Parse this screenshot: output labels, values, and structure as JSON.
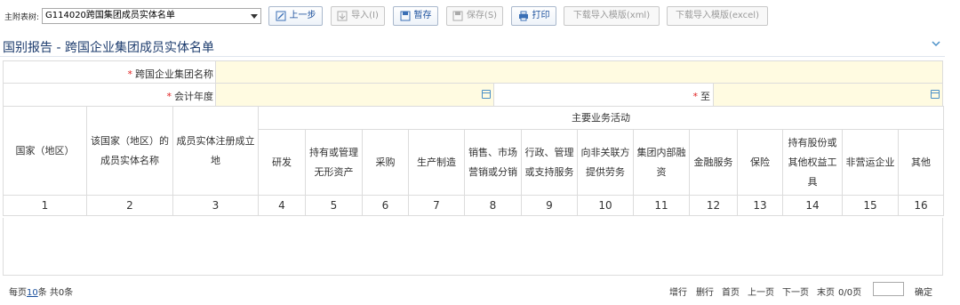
{
  "toolbar": {
    "label": "主附表树:",
    "select_value": "G114020跨国集团成员实体名单",
    "buttons": [
      {
        "label": "上一步",
        "icon": "edit-icon"
      },
      {
        "label": "导入(I)",
        "icon": "import-icon"
      },
      {
        "label": "暂存",
        "icon": "save-icon"
      },
      {
        "label": "保存(S)",
        "icon": "save-icon"
      },
      {
        "label": "打印",
        "icon": "print-icon"
      },
      {
        "label": "下载导入模版(xml)"
      },
      {
        "label": "下载导入模版(excel)"
      }
    ]
  },
  "section": {
    "title": "国别报告 - 跨国企业集团成员实体名单"
  },
  "form": {
    "group_name_label": "跨国企业集团名称",
    "fiscal_year_label": "会计年度",
    "to_label": "至",
    "required_mark": "*"
  },
  "table": {
    "col_country": "国家（地区）",
    "col_member_name": "该国家（地区）的成员实体名称",
    "col_reg_place": "成员实体注册成立地",
    "group_header": "主要业务活动",
    "activities": [
      "研发",
      "持有或管理无形资产",
      "采购",
      "生产制造",
      "销售、市场营销或分销",
      "行政、管理或支持服务",
      "向非关联方提供劳务",
      "集团内部融资",
      "金融服务",
      "保险",
      "持有股份或其他权益工具",
      "非营运企业",
      "其他"
    ],
    "numbers": [
      "1",
      "2",
      "3",
      "4",
      "5",
      "6",
      "7",
      "8",
      "9",
      "10",
      "11",
      "12",
      "13",
      "14",
      "15",
      "16"
    ]
  },
  "pager": {
    "per_page_prefix": "每页",
    "per_page_value": "10",
    "per_page_suffix": "条 共0条",
    "add_row": "增行",
    "delete_row": "删行",
    "first": "首页",
    "prev": "上一页",
    "next": "下一页",
    "last": "末页",
    "page_info": "0/0页",
    "confirm": "确定"
  }
}
